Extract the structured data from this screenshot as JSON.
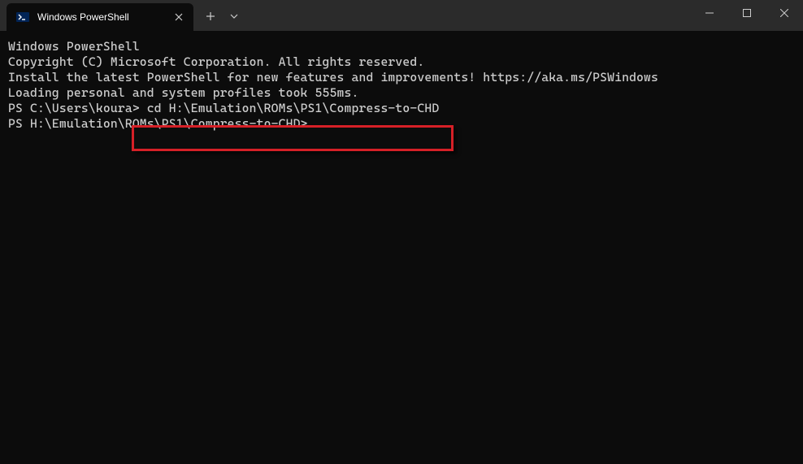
{
  "window": {
    "tab_title": "Windows PowerShell"
  },
  "terminal": {
    "lines": {
      "l0": "Windows PowerShell",
      "l1": "Copyright (C) Microsoft Corporation. All rights reserved.",
      "l2": "",
      "l3": "Install the latest PowerShell for new features and improvements! https://aka.ms/PSWindows",
      "l4": "",
      "l5": "Loading personal and system profiles took 555ms.",
      "prompt1_prefix": "PS C:\\Users\\koura> ",
      "prompt1_command": "cd H:\\Emulation\\ROMs\\PS1\\Compress-to-CHD",
      "prompt2": "PS H:\\Emulation\\ROMs\\PS1\\Compress-to-CHD>"
    }
  }
}
